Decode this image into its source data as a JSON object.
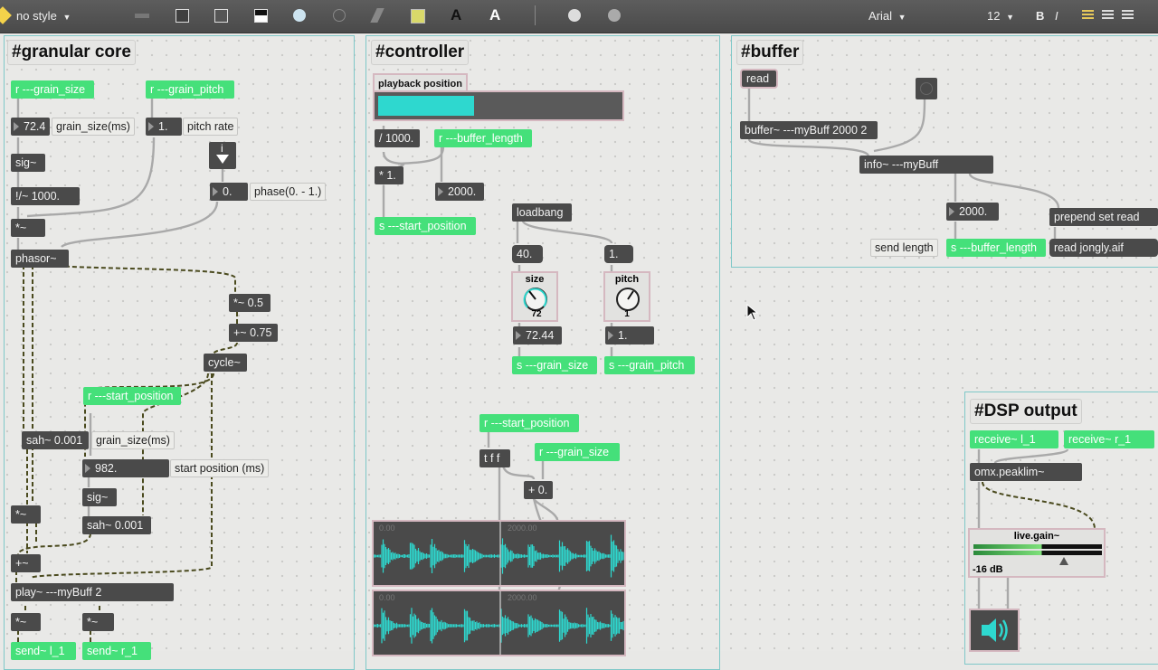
{
  "toolbar": {
    "style_label": "no style",
    "font_name": "Arial",
    "font_size": "12",
    "bold": "B",
    "italic": "I",
    "text_a": "A"
  },
  "granular": {
    "title": "#granular core",
    "r_grain_size": "r ---grain_size",
    "r_grain_pitch": "r ---grain_pitch",
    "num_grain_size": "72.4",
    "cmt_grain_size": "grain_size(ms)",
    "num_pitch": "1.",
    "cmt_pitch": "pitch rate",
    "sig1": "sig~",
    "div": "!/~ 1000.",
    "mul1": "*~",
    "num_phase": "0.",
    "cmt_phase": "phase(0. - 1.)",
    "phasor": "phasor~",
    "mul_half": "*~ 0.5",
    "add_075": "+~ 0.75",
    "cycle": "cycle~",
    "r_start_position": "r ---start_position",
    "sah1": "sah~ 0.001",
    "cmt_grain_size2": "grain_size(ms)",
    "num_start": "982.",
    "cmt_start": "start position (ms)",
    "sig2": "sig~",
    "sah2": "sah~ 0.001",
    "mul2": "*~",
    "add": "+~",
    "play": "play~ ---myBuff 2",
    "mul3": "*~",
    "mul4": "*~",
    "send_l": "send~ l_1",
    "send_r": "send~ r_1"
  },
  "controller": {
    "title": "#controller",
    "playback_label": "playback position",
    "playback_value": 0.4,
    "div1000": "/ 1000.",
    "r_buffer_length": "r ---buffer_length",
    "mul1": "* 1.",
    "num2000": "2000.",
    "s_start_position": "s ---start_position",
    "loadbang": "loadbang",
    "msg40": "40.",
    "msg1": "1.",
    "dial_size_label": "size",
    "dial_size_value": "72",
    "dial_pitch_label": "pitch",
    "dial_pitch_value": "1",
    "num_size": "72.44",
    "num_pitch": "1.",
    "s_grain_size": "s ---grain_size",
    "s_grain_pitch": "s ---grain_pitch",
    "r_start_position": "r ---start_position",
    "tff": "t f f",
    "r_grain_size": "r ---grain_size",
    "add0": "+ 0.",
    "wave_time1": "0.00",
    "wave_time1b": "2000.00",
    "wave_time2": "0.00",
    "wave_time2b": "2000.00"
  },
  "buffer": {
    "title": "#buffer",
    "read": "read",
    "buffer_obj": "buffer~ ---myBuff 2000 2",
    "info": "info~ ---myBuff",
    "num2000": "2000.",
    "prepend": "prepend set read",
    "send_length": "send length",
    "s_buffer_length": "s ---buffer_length",
    "read_file": "read jongly.aif"
  },
  "dsp": {
    "title": "#DSP output",
    "receive_l": "receive~ l_1",
    "receive_r": "receive~ r_1",
    "peaklim": "omx.peaklim~",
    "gain_label": "live.gain~",
    "gain_db": "-16 dB"
  },
  "colors": {
    "accent_teal": "#2ed8cf",
    "send_green": "#45e07a",
    "object_dark": "#4a4a4a",
    "panel_border": "#7fc8c8"
  }
}
